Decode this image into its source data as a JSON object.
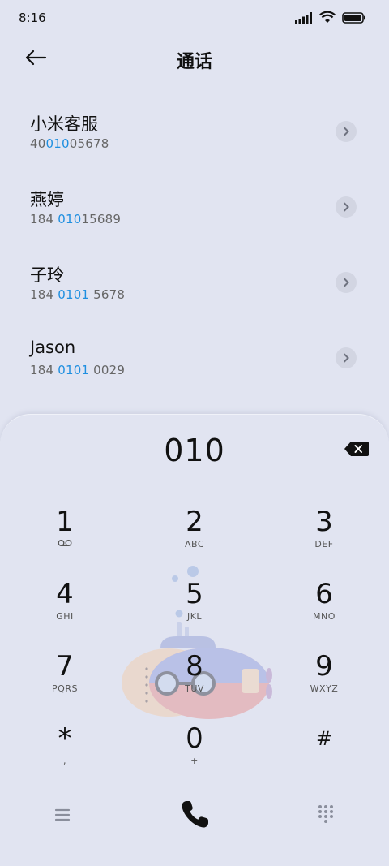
{
  "status": {
    "time": "8:16"
  },
  "header": {
    "title": "通话"
  },
  "contacts": [
    {
      "name": "小米客服",
      "num_pre": "40",
      "num_hl": "010",
      "num_post": "05678"
    },
    {
      "name": "燕婷",
      "num_pre": "184 ",
      "num_hl": "010",
      "num_post": "15689"
    },
    {
      "name": "子玲",
      "num_pre": "184 ",
      "num_hl": "0101",
      "num_post": " 5678"
    },
    {
      "name": "Jason",
      "num_pre": "184 ",
      "num_hl": "0101",
      "num_post": " 0029"
    }
  ],
  "dialpad": {
    "digits": "010",
    "keys": [
      {
        "d": "1",
        "l": "voicemail"
      },
      {
        "d": "2",
        "l": "ABC"
      },
      {
        "d": "3",
        "l": "DEF"
      },
      {
        "d": "4",
        "l": "GHI"
      },
      {
        "d": "5",
        "l": "JKL"
      },
      {
        "d": "6",
        "l": "MNO"
      },
      {
        "d": "7",
        "l": "PQRS"
      },
      {
        "d": "8",
        "l": "TUV"
      },
      {
        "d": "9",
        "l": "WXYZ"
      },
      {
        "d": "*",
        "l": ","
      },
      {
        "d": "0",
        "l": "+"
      },
      {
        "d": "#",
        "l": ""
      }
    ]
  },
  "colors": {
    "background": "#e1e4f1",
    "highlight": "#1f8fe0",
    "text": "#111111"
  },
  "icons": {
    "back": "arrow-left-icon",
    "chevron": "chevron-right-icon",
    "backspace": "backspace-icon",
    "menu": "menu-icon",
    "call": "phone-icon",
    "dialpad": "dialpad-icon"
  }
}
